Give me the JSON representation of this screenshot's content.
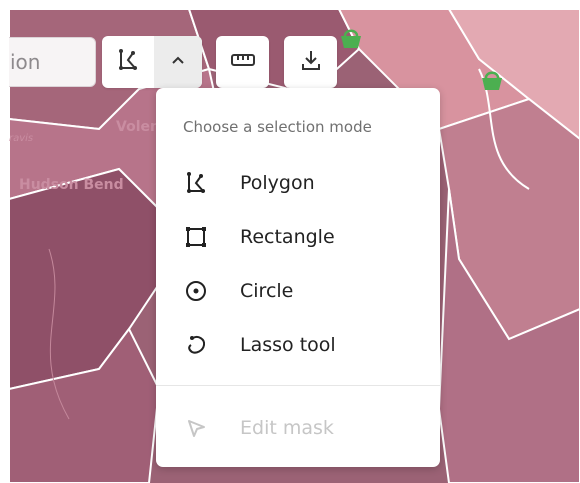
{
  "search": {
    "visible_text": "ion"
  },
  "toolbar": {
    "polygon_tool_icon": "polygon-select-icon",
    "mode_toggle_icon": "chevron-up-icon",
    "measure_icon": "ruler-icon",
    "download_icon": "download-icon"
  },
  "map": {
    "labels": {
      "hudson_bend": "Hudson Bend",
      "volente": "Volen",
      "travis": "ravis"
    },
    "poi_icon": "basket-icon",
    "colors": {
      "region_dark": "#8f5068",
      "region_medium": "#a5667a",
      "region_light": "#c07f90",
      "region_pale": "#e3a9b2",
      "poi_green": "#4caf50"
    }
  },
  "menu": {
    "title": "Choose a selection mode",
    "items": [
      {
        "label": "Polygon",
        "icon": "polygon-select-icon",
        "disabled": false
      },
      {
        "label": "Rectangle",
        "icon": "rectangle-select-icon",
        "disabled": false
      },
      {
        "label": "Circle",
        "icon": "circle-select-icon",
        "disabled": false
      },
      {
        "label": "Lasso tool",
        "icon": "lasso-icon",
        "disabled": false
      },
      {
        "label": "Edit mask",
        "icon": "cursor-arrow-icon",
        "disabled": true
      }
    ]
  }
}
